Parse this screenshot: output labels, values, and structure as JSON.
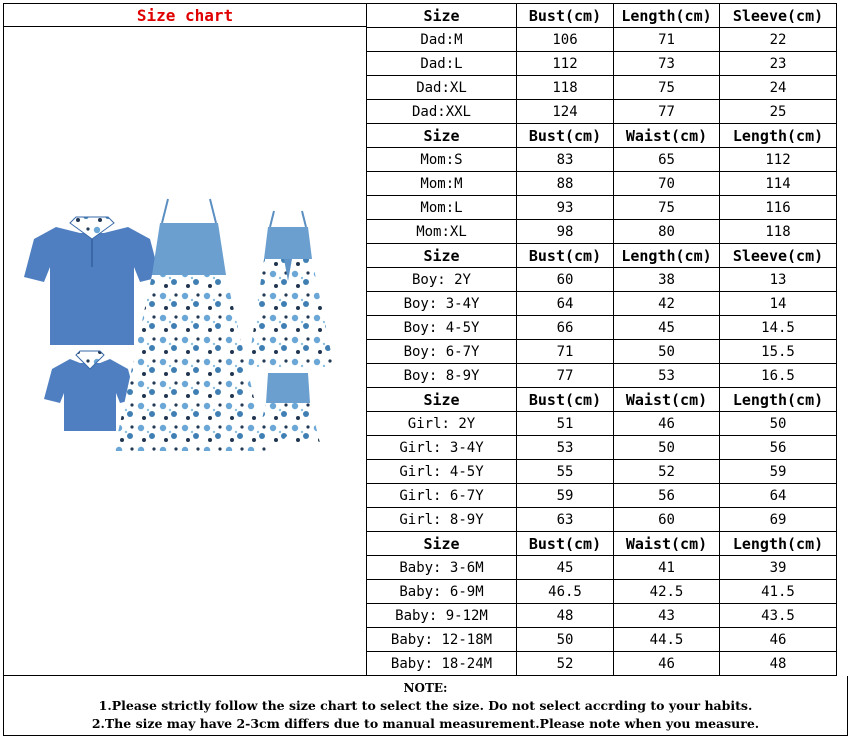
{
  "title": "Size chart",
  "colors": {
    "title": "#e00000",
    "denim": "#4f7fc0",
    "floral": "#6aa6d6"
  },
  "sections": [
    {
      "headers": [
        "Size",
        "Bust(cm)",
        "Length(cm)",
        "Sleeve(cm)"
      ],
      "rows": [
        [
          "Dad:M",
          "106",
          "71",
          "22"
        ],
        [
          "Dad:L",
          "112",
          "73",
          "23"
        ],
        [
          "Dad:XL",
          "118",
          "75",
          "24"
        ],
        [
          "Dad:XXL",
          "124",
          "77",
          "25"
        ]
      ]
    },
    {
      "headers": [
        "Size",
        "Bust(cm)",
        "Waist(cm)",
        "Length(cm)"
      ],
      "rows": [
        [
          "Mom:S",
          "83",
          "65",
          "112"
        ],
        [
          "Mom:M",
          "88",
          "70",
          "114"
        ],
        [
          "Mom:L",
          "93",
          "75",
          "116"
        ],
        [
          "Mom:XL",
          "98",
          "80",
          "118"
        ]
      ]
    },
    {
      "headers": [
        "Size",
        "Bust(cm)",
        "Length(cm)",
        "Sleeve(cm)"
      ],
      "rows": [
        [
          "Boy: 2Y",
          "60",
          "38",
          "13"
        ],
        [
          "Boy: 3-4Y",
          "64",
          "42",
          "14"
        ],
        [
          "Boy: 4-5Y",
          "66",
          "45",
          "14.5"
        ],
        [
          "Boy: 6-7Y",
          "71",
          "50",
          "15.5"
        ],
        [
          "Boy: 8-9Y",
          "77",
          "53",
          "16.5"
        ]
      ]
    },
    {
      "headers": [
        "Size",
        "Bust(cm)",
        "Waist(cm)",
        "Length(cm)"
      ],
      "rows": [
        [
          "Girl: 2Y",
          "51",
          "46",
          "50"
        ],
        [
          "Girl: 3-4Y",
          "53",
          "50",
          "56"
        ],
        [
          "Girl: 4-5Y",
          "55",
          "52",
          "59"
        ],
        [
          "Girl: 6-7Y",
          "59",
          "56",
          "64"
        ],
        [
          "Girl: 8-9Y",
          "63",
          "60",
          "69"
        ]
      ]
    },
    {
      "headers": [
        "Size",
        "Bust(cm)",
        "Waist(cm)",
        "Length(cm)"
      ],
      "rows": [
        [
          "Baby: 3-6M",
          "45",
          "41",
          "39"
        ],
        [
          "Baby: 6-9M",
          "46.5",
          "42.5",
          "41.5"
        ],
        [
          "Baby: 9-12M",
          "48",
          "43",
          "43.5"
        ],
        [
          "Baby: 12-18M",
          "50",
          "44.5",
          "46"
        ],
        [
          "Baby: 18-24M",
          "52",
          "46",
          "48"
        ]
      ]
    }
  ],
  "note": {
    "title": "NOTE:",
    "lines": [
      "1.Please strictly follow the size chart to select the size. Do not select accrding to your habits.",
      "2.The size may have 2-3cm differs  due to manual measurement.Please note when you measure."
    ]
  }
}
